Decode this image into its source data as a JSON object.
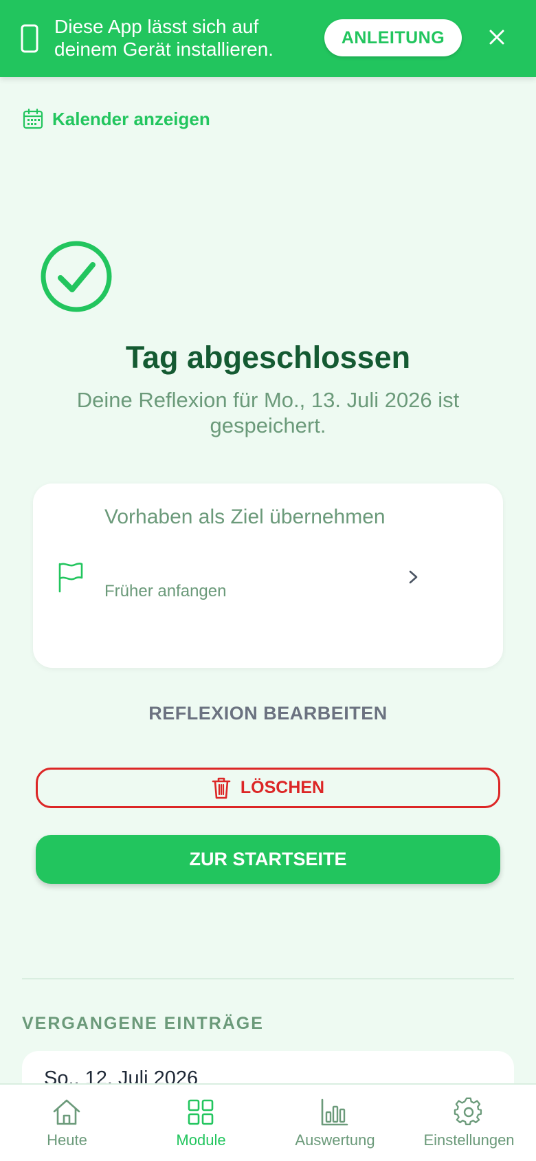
{
  "banner": {
    "message_line1": "Diese App lässt sich auf",
    "message_line2": "deinem Gerät installieren.",
    "guide_label": "ANLEITUNG",
    "phone_icon": "smartphone-icon",
    "close_icon": "close-icon"
  },
  "calendar": {
    "label": "Kalender anzeigen",
    "icon": "calendar-icon"
  },
  "status": {
    "icon": "check-circle-icon",
    "title": "Tag abgeschlossen",
    "subtitle": "Deine Reflexion für Mo., 13. Juli 2026 ist gespeichert."
  },
  "goal_card": {
    "title": "Vorhaben als Ziel übernehmen",
    "icon": "flag-icon",
    "item": "Früher anfangen",
    "chevron_icon": "chevron-right-icon"
  },
  "actions": {
    "edit_label": "REFLEXION BEARBEITEN",
    "delete_label": "LÖSCHEN",
    "delete_icon": "trash-icon",
    "home_label": "ZUR STARTSEITE"
  },
  "past_entries": {
    "title": "VERGANGENE EINTRÄGE",
    "entries": [
      {
        "date": "So., 12. Juli 2026"
      }
    ]
  },
  "bottom_nav": {
    "items": [
      {
        "label": "Heute",
        "icon": "home-icon",
        "active": false
      },
      {
        "label": "Module",
        "icon": "grid-icon",
        "active": true
      },
      {
        "label": "Auswertung",
        "icon": "bar-chart-icon",
        "active": false
      },
      {
        "label": "Einstellungen",
        "icon": "gear-icon",
        "active": false
      }
    ]
  },
  "colors": {
    "accent": "#22c55e",
    "background": "#eefaf2",
    "title": "#145a32",
    "muted": "#6b9a7a",
    "danger": "#dc2626"
  }
}
